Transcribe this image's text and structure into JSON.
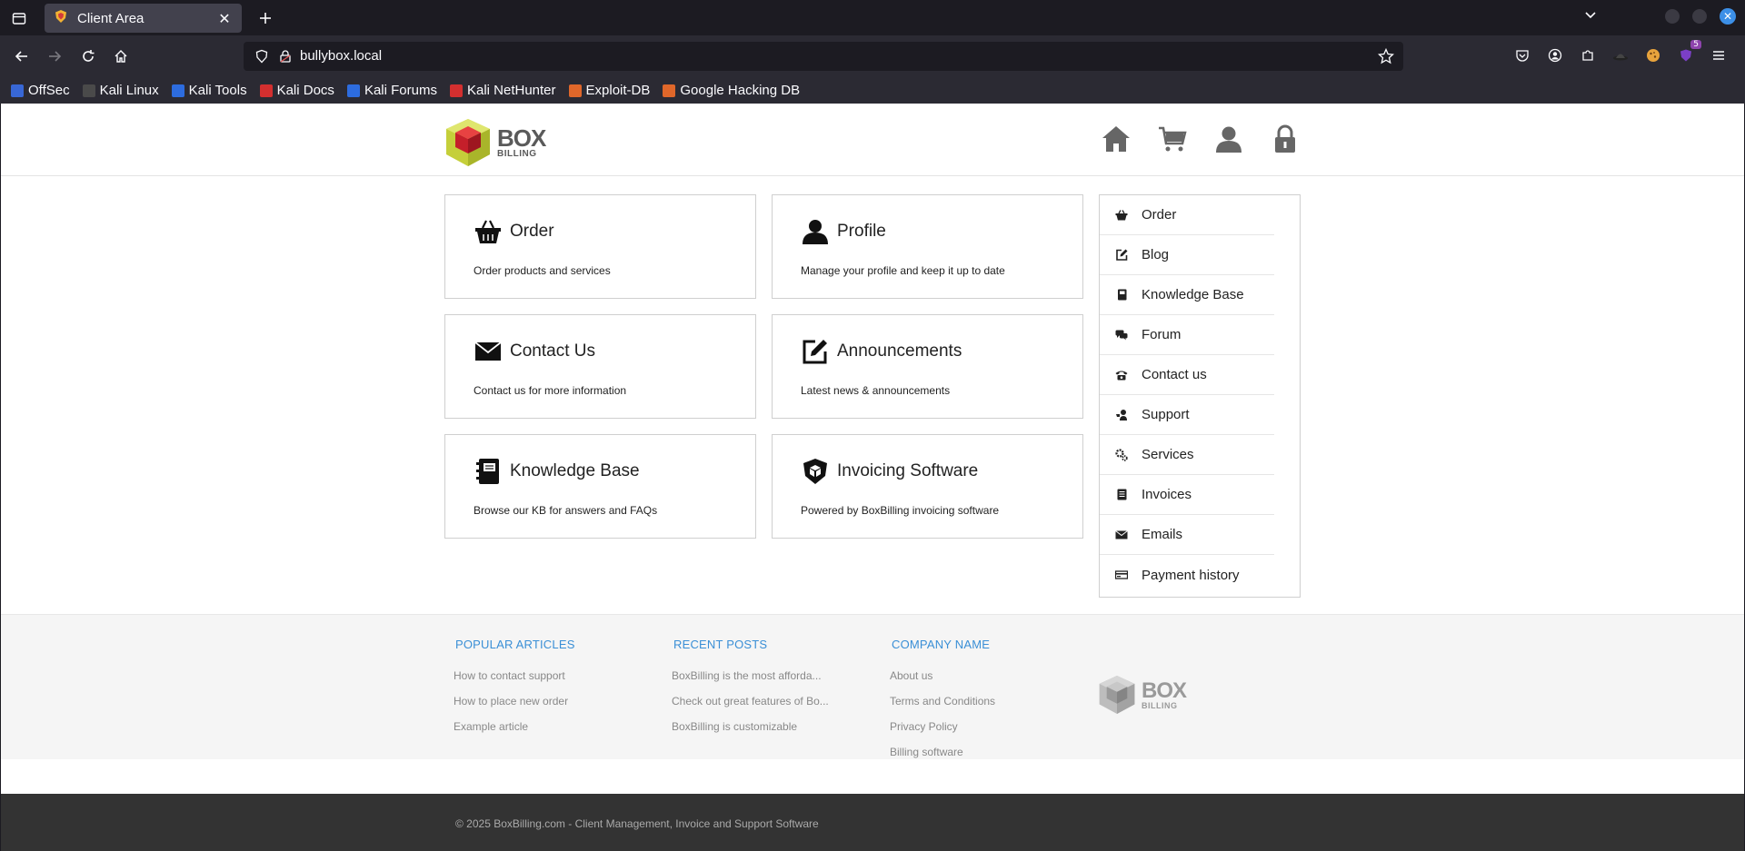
{
  "browser": {
    "tab_title": "Client Area",
    "url": "bullybox.local",
    "badge_count": "5",
    "bookmarks": [
      {
        "label": "OffSec",
        "color": "#3867d6"
      },
      {
        "label": "Kali Linux",
        "color": "#4a4a4a"
      },
      {
        "label": "Kali Tools",
        "color": "#2d6cdf"
      },
      {
        "label": "Kali Docs",
        "color": "#d32f2f"
      },
      {
        "label": "Kali Forums",
        "color": "#2d6cdf"
      },
      {
        "label": "Kali NetHunter",
        "color": "#d32f2f"
      },
      {
        "label": "Exploit-DB",
        "color": "#e0672a"
      },
      {
        "label": "Google Hacking DB",
        "color": "#e0672a"
      }
    ]
  },
  "site": {
    "logo": {
      "box": "BOX",
      "billing": "BILLING"
    },
    "cards": [
      {
        "icon": "basket-icon",
        "title": "Order",
        "desc": "Order products and services"
      },
      {
        "icon": "user-icon",
        "title": "Profile",
        "desc": "Manage your profile and keep it up to date"
      },
      {
        "icon": "envelope-icon",
        "title": "Contact Us",
        "desc": "Contact us for more information"
      },
      {
        "icon": "edit-icon",
        "title": "Announcements",
        "desc": "Latest news & announcements"
      },
      {
        "icon": "book-icon",
        "title": "Knowledge Base",
        "desc": "Browse our KB for answers and FAQs"
      },
      {
        "icon": "shield-icon",
        "title": "Invoicing Software",
        "desc": "Powered by BoxBilling invoicing software"
      }
    ],
    "sidebar": [
      {
        "icon": "basket-icon",
        "label": "Order"
      },
      {
        "icon": "edit-icon",
        "label": "Blog"
      },
      {
        "icon": "book-icon",
        "label": "Knowledge Base"
      },
      {
        "icon": "chat-icon",
        "label": "Forum"
      },
      {
        "icon": "phone-icon",
        "label": "Contact us"
      },
      {
        "icon": "support-icon",
        "label": "Support"
      },
      {
        "icon": "cogs-icon",
        "label": "Services"
      },
      {
        "icon": "invoice-icon",
        "label": "Invoices"
      },
      {
        "icon": "envelope-icon",
        "label": "Emails"
      },
      {
        "icon": "money-icon",
        "label": "Payment history"
      }
    ],
    "footer": {
      "popular": {
        "title": "POPULAR ARTICLES",
        "links": [
          "How to contact support",
          "How to place new order",
          "Example article"
        ]
      },
      "recent": {
        "title": "RECENT POSTS",
        "links": [
          "BoxBilling is the most afforda...",
          "Check out great features of Bo...",
          "BoxBilling is customizable"
        ]
      },
      "company": {
        "title": "COMPANY NAME",
        "links": [
          "About us",
          "Terms and Conditions",
          "Privacy Policy",
          "Billing software"
        ]
      },
      "copyright": "© 2025 BoxBilling.com - Client Management, Invoice and Support Software"
    }
  }
}
